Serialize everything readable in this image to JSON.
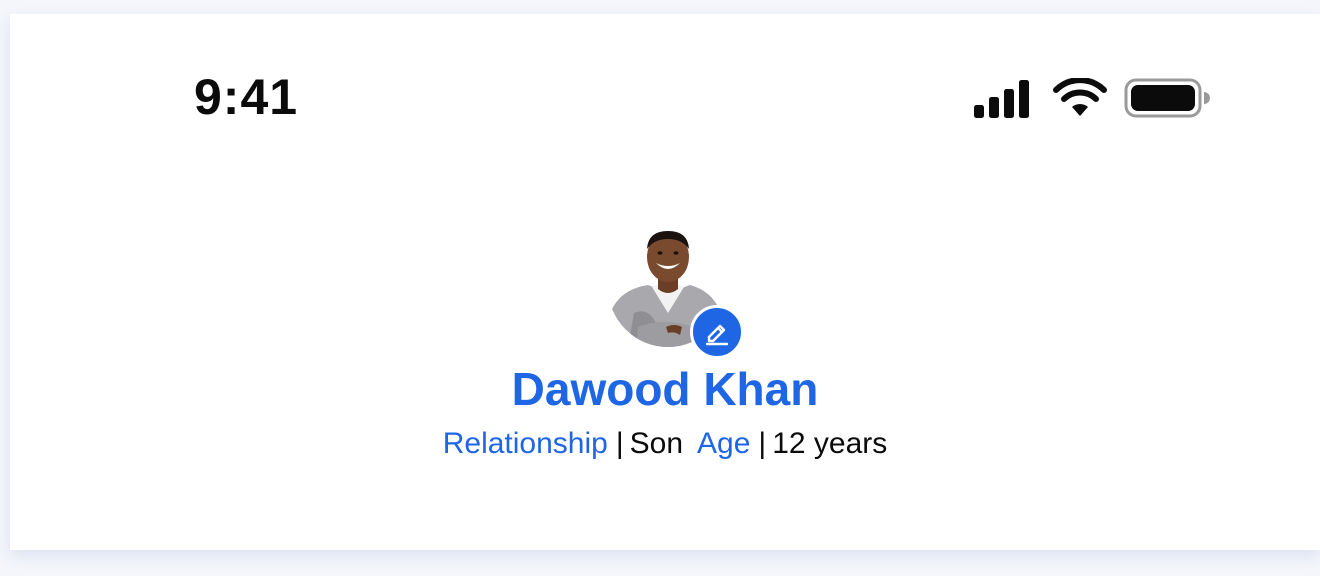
{
  "status_bar": {
    "time": "9:41",
    "icons": [
      "signal-icon",
      "wifi-icon",
      "battery-icon"
    ]
  },
  "profile": {
    "name": "Dawood Khan",
    "relationship_label": "Relationship",
    "relationship_value": "Son",
    "age_label": "Age",
    "age_value": "12 years",
    "separator": "|",
    "edit_icon": "pencil-icon"
  },
  "colors": {
    "accent": "#1f66e5",
    "text": "#0b0b0b",
    "background": "#ffffff"
  }
}
